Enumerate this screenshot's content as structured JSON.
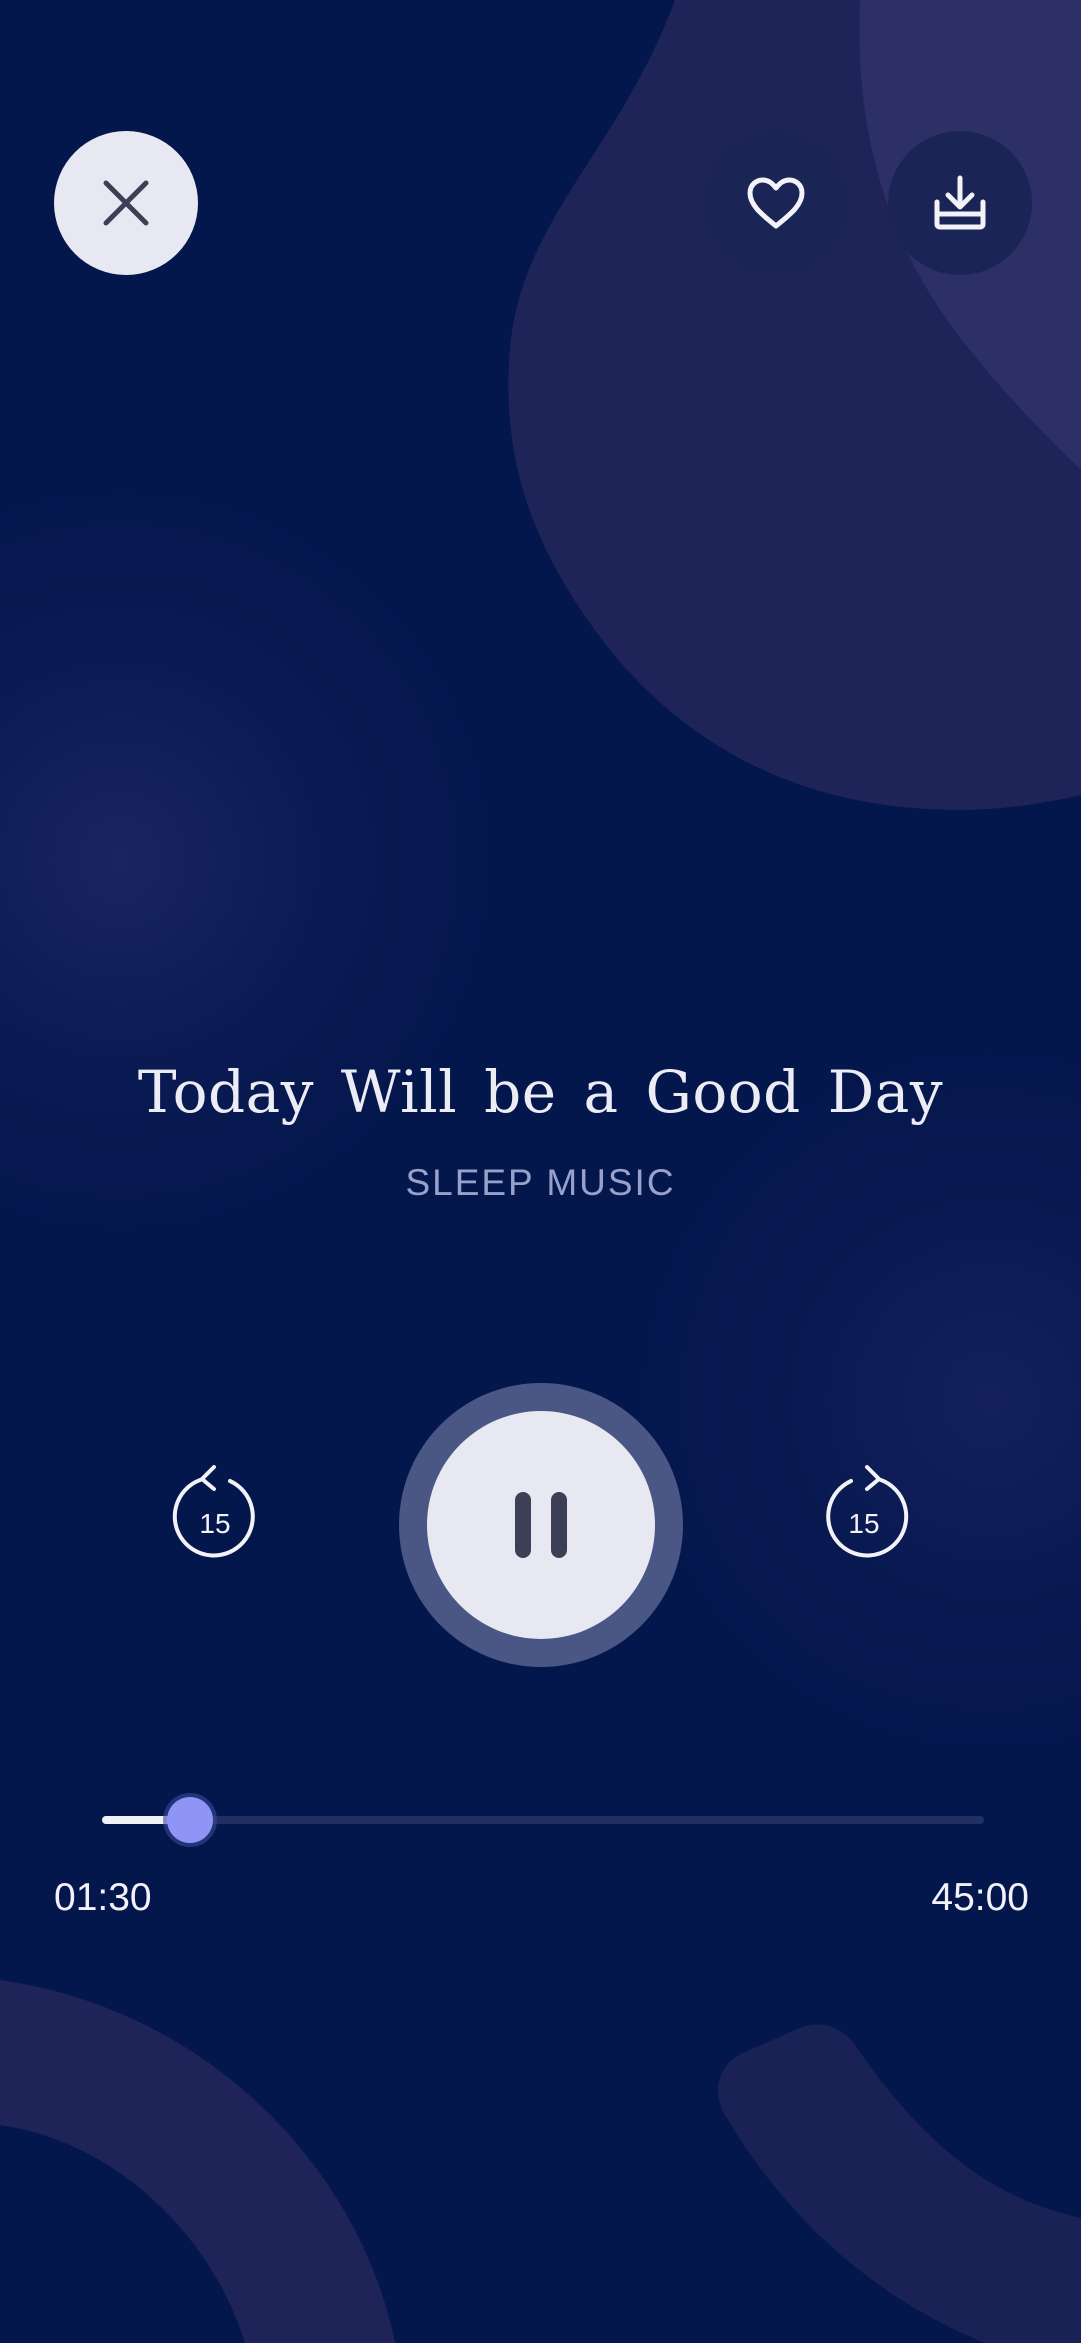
{
  "player": {
    "title": "Today Will be a Good Day",
    "category": "SLEEP MUSIC",
    "state": "playing",
    "skip_back_seconds": "15",
    "skip_forward_seconds": "15",
    "elapsed": "01:30",
    "duration": "45:00",
    "progress_fraction": 0.1
  },
  "icons": {
    "close": "close-icon",
    "favorite": "heart-icon",
    "download": "download-icon",
    "skip_back": "rewind-15-icon",
    "play_pause": "pause-icon",
    "skip_forward": "forward-15-icon"
  },
  "colors": {
    "background": "#04174D",
    "blob": "#1F2458",
    "accent": "#8F95F5",
    "light_button": "#E8E8F3"
  }
}
